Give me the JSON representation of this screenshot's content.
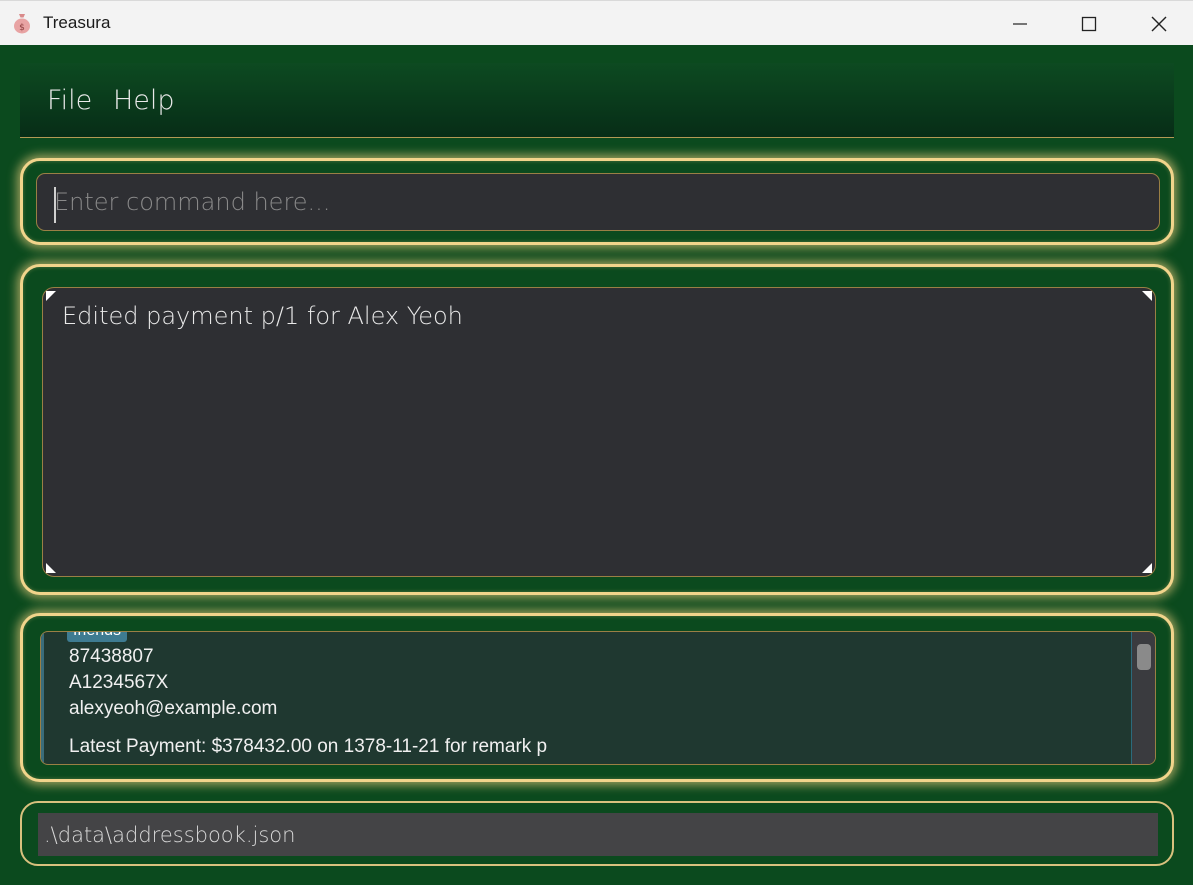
{
  "window": {
    "title": "Treasura",
    "icon": "money-bag-icon",
    "controls": [
      "minimize-icon",
      "maximize-icon",
      "close-icon"
    ]
  },
  "menu": {
    "file_label": "File",
    "help_label": "Help"
  },
  "command": {
    "placeholder": "Enter command here...",
    "value": ""
  },
  "result": {
    "message": "Edited payment p/1 for Alex Yeoh"
  },
  "person_list": {
    "items": [
      {
        "tag": "friends",
        "phone": "87438807",
        "id": "A1234567X",
        "email": "alexyeoh@example.com",
        "latest_payment": "Latest Payment: $378432.00 on 1378-11-21 for remark p"
      }
    ]
  },
  "status_bar": {
    "file_path": ".\\data\\addressbook.json"
  },
  "colors": {
    "background": "#0b4a1e",
    "panel_border": "#f1d48b",
    "input_background": "#2e2f33",
    "list_background": "#1f3830",
    "tag_background": "#3e7b91"
  }
}
